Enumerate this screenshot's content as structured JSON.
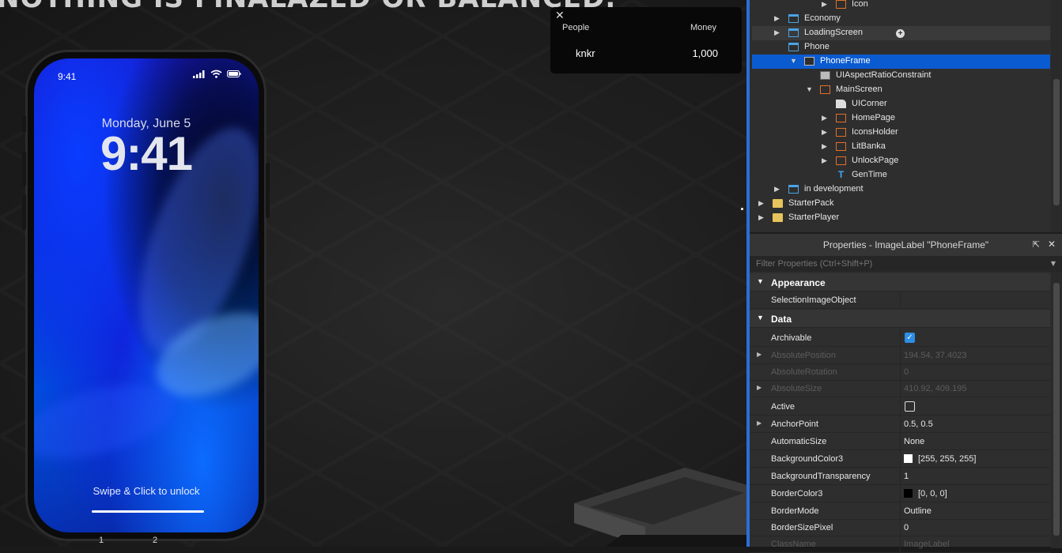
{
  "viewport": {
    "banner": "NOTHING IS FINALAZED OR BALANCED.",
    "leaderboard": {
      "close_glyph": "✕",
      "col_people": "People",
      "col_money": "Money",
      "rows": [
        {
          "name": "knkr",
          "money": "1,000"
        }
      ]
    },
    "phone": {
      "status_time": "9:41",
      "date": "Monday, June 5",
      "time": "9:41",
      "unlock_text": "Swipe & Click to unlock",
      "pages": [
        "1",
        "2"
      ]
    }
  },
  "explorer": {
    "items": [
      {
        "label": "Icon",
        "depth": 4,
        "icon": "frame-icon",
        "arrow": "collapsed"
      },
      {
        "label": "Economy",
        "depth": 1,
        "icon": "screengui-icon",
        "arrow": "collapsed"
      },
      {
        "label": "LoadingScreen",
        "depth": 1,
        "icon": "screengui-icon",
        "arrow": "collapsed",
        "hover": true
      },
      {
        "label": "Phone",
        "depth": 1,
        "icon": "screengui-icon",
        "arrow": "none"
      },
      {
        "label": "PhoneFrame",
        "depth": 2,
        "icon": "imagelabel-icon",
        "arrow": "expanded",
        "selected": true
      },
      {
        "label": "UIAspectRatioConstraint",
        "depth": 3,
        "icon": "constraint-icon",
        "arrow": "none"
      },
      {
        "label": "MainScreen",
        "depth": 3,
        "icon": "frame-icon",
        "arrow": "expanded"
      },
      {
        "label": "UICorner",
        "depth": 4,
        "icon": "uicorner-icon",
        "arrow": "none"
      },
      {
        "label": "HomePage",
        "depth": 4,
        "icon": "frame-icon",
        "arrow": "collapsed"
      },
      {
        "label": "IconsHolder",
        "depth": 4,
        "icon": "frame-icon",
        "arrow": "collapsed"
      },
      {
        "label": "LitBanka",
        "depth": 4,
        "icon": "frame-icon",
        "arrow": "collapsed"
      },
      {
        "label": "UnlockPage",
        "depth": 4,
        "icon": "frame-icon",
        "arrow": "collapsed"
      },
      {
        "label": "GenTime",
        "depth": 4,
        "icon": "textlabel-icon",
        "arrow": "none"
      },
      {
        "label": "in development",
        "depth": 1,
        "icon": "screengui-icon",
        "arrow": "collapsed"
      },
      {
        "label": "StarterPack",
        "depth": 0,
        "icon": "folder-icon",
        "arrow": "collapsed"
      },
      {
        "label": "StarterPlayer",
        "depth": 0,
        "icon": "folder-icon",
        "arrow": "collapsed"
      }
    ]
  },
  "properties": {
    "title": "Properties - ImageLabel \"PhoneFrame\"",
    "filter_placeholder": "Filter Properties (Ctrl+Shift+P)",
    "sections": {
      "appearance": "Appearance",
      "data": "Data"
    },
    "rows": {
      "selection_image_object": {
        "name": "SelectionImageObject",
        "value": ""
      },
      "archivable": {
        "name": "Archivable",
        "checked": true
      },
      "absolute_position": {
        "name": "AbsolutePosition",
        "value": "194.54, 37.4023"
      },
      "absolute_rotation": {
        "name": "AbsoluteRotation",
        "value": "0"
      },
      "absolute_size": {
        "name": "AbsoluteSize",
        "value": "410.92, 409.195"
      },
      "active": {
        "name": "Active",
        "checked": false
      },
      "anchor_point": {
        "name": "AnchorPoint",
        "value": "0.5, 0.5"
      },
      "automatic_size": {
        "name": "AutomaticSize",
        "value": "None"
      },
      "background_color3": {
        "name": "BackgroundColor3",
        "value": "[255, 255, 255]",
        "color": "#ffffff"
      },
      "background_transparency": {
        "name": "BackgroundTransparency",
        "value": "1"
      },
      "border_color3": {
        "name": "BorderColor3",
        "value": "[0, 0, 0]",
        "color": "#000000"
      },
      "border_mode": {
        "name": "BorderMode",
        "value": "Outline"
      },
      "border_size_pixel": {
        "name": "BorderSizePixel",
        "value": "0"
      },
      "class_name": {
        "name": "ClassName",
        "value": "ImageLabel"
      }
    }
  },
  "colors": {
    "accent": "#0b5bd0",
    "frame_icon": "#e0702a",
    "gui_icon": "#4aa3e6"
  }
}
